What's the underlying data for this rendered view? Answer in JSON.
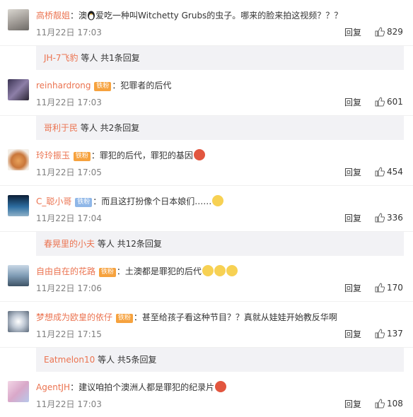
{
  "comments": [
    {
      "user": "高桥靓姐",
      "text_pre": "澳",
      "text_post": "爱吃一种叫Witchetty Grubs的虫子。哪来的脸来拍这视频？？？",
      "time": "11月22日 17:03",
      "reply": "回复",
      "likes": "829"
    },
    {
      "user": "reinhardrong",
      "badge": "铁粉",
      "text": "：犯罪者的后代",
      "time": "11月22日 17:03",
      "reply": "回复",
      "likes": "601"
    },
    {
      "user": "玲玲振玉",
      "badge": "铁粉",
      "text": "：罪犯的后代，罪犯的基因",
      "time": "11月22日 17:05",
      "reply": "回复",
      "likes": "454"
    },
    {
      "user": "C_聪小哥",
      "badge": "铁粉",
      "text": "：而且这打扮像个日本娘们……",
      "time": "11月22日 17:04",
      "reply": "回复",
      "likes": "336"
    },
    {
      "user": "自由自在的花路",
      "badge": "铁粉",
      "text": "：土澳都是罪犯的后代",
      "time": "11月22日 17:06",
      "reply": "回复",
      "likes": "170"
    },
    {
      "user": "梦想成为欧皇的依仔",
      "badge": "铁粉",
      "text": "：甚至给孩子看这种节目？？真就从娃娃开始教反华啊",
      "time": "11月22日 17:15",
      "reply": "回复",
      "likes": "137"
    },
    {
      "user": "AgentJH",
      "text": "：建议咱拍个澳洲人都是罪犯的纪录片",
      "time": "11月22日 17:03",
      "reply": "回复",
      "likes": "108"
    }
  ],
  "threads": [
    {
      "user": "JH-7飞豹",
      "rest": " 等人 共1条回复"
    },
    {
      "user": "哥利于民",
      "rest": " 等人 共2条回复"
    },
    {
      "user": "春晃里的小夫",
      "rest": " 等人 共12条回复"
    },
    {
      "user": "Eatmelon10",
      "rest": " 等人 共5条回复"
    }
  ],
  "colors": {
    "username": "#eb7350",
    "thread_bg": "#f2f2f5",
    "badge": "#f6a23e"
  },
  "icons": [
    "qq-penguin-icon",
    "fan-badge-icon",
    "angry-emoji-icon",
    "smirk-emoji-icon",
    "thumbs-up-icon"
  ]
}
